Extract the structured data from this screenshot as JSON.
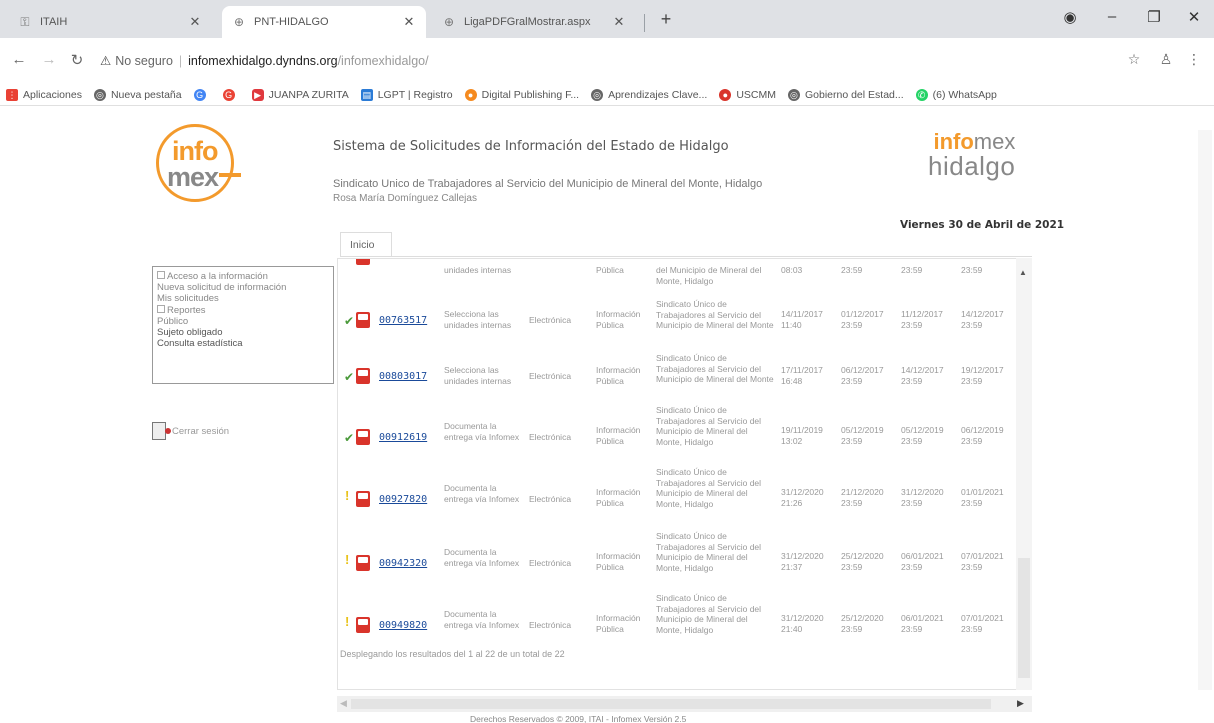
{
  "browser": {
    "tabs": [
      {
        "label": "ITAIH",
        "active": false
      },
      {
        "label": "PNT-HIDALGO",
        "active": true
      },
      {
        "label": "LigaPDFGralMostrar.aspx",
        "active": false
      }
    ],
    "address": {
      "security": "No seguro",
      "host": "infomexhidalgo.dyndns.org",
      "path": "/infomexhidalgo/"
    },
    "bookmarks": [
      {
        "label": "Aplicaciones",
        "icon": "apps-grid-icon",
        "color": "#e94235"
      },
      {
        "label": "Nueva pestaña",
        "icon": "globe-icon",
        "color": "#666666"
      },
      {
        "label": "",
        "icon": "google-icon",
        "color": "#4285f4"
      },
      {
        "label": "",
        "icon": "google-icon",
        "color": "#ea4335"
      },
      {
        "label": "JUANPA ZURITA",
        "icon": "youtube-icon",
        "color": "#e0393e"
      },
      {
        "label": "LGPT | Registro",
        "icon": "flag-icon",
        "color": "#2b7bd6"
      },
      {
        "label": "Digital Publishing F...",
        "icon": "circle-icon",
        "color": "#f58a1f"
      },
      {
        "label": "Aprendizajes Clave...",
        "icon": "globe-icon",
        "color": "#666666"
      },
      {
        "label": "USCMM",
        "icon": "circle-icon",
        "color": "#d9342b"
      },
      {
        "label": "Gobierno del Estad...",
        "icon": "globe-icon",
        "color": "#666666"
      },
      {
        "label": "(6) WhatsApp",
        "icon": "whatsapp-icon",
        "color": "#25d366"
      }
    ]
  },
  "header": {
    "logo_left_top": "info",
    "logo_left_bottom": "mex",
    "title": "Sistema de Solicitudes de Información del Estado de Hidalgo",
    "subtitle": "Sindicato Unico de Trabajadores al Servicio del Municipio de Mineral del Monte, Hidalgo",
    "user": "Rosa María Domínguez Callejas",
    "logo_right_a": "info",
    "logo_right_b": "mex",
    "logo_right_c": "hidalgo",
    "date": "Viernes 30 de Abril de 2021"
  },
  "tabs": {
    "inicio": "Inicio"
  },
  "menu": {
    "items": [
      {
        "label": "Acceso a la información",
        "square": true
      },
      {
        "label": "Nueva solicitud de información",
        "square": false
      },
      {
        "label": "Mis solicitudes",
        "square": false
      },
      {
        "label": "Reportes",
        "square": true
      },
      {
        "label": "Público",
        "square": false
      },
      {
        "label": "Sujeto obligado",
        "square": false
      },
      {
        "label": "Consulta estadística",
        "square": false
      }
    ],
    "logout": "Cerrar sesión"
  },
  "results": {
    "partial_row": {
      "desc": "unidades internas",
      "tipo": "Electrónica",
      "info": "Pública",
      "sujeto": "del Municipio de Mineral del Monte, Hidalgo",
      "d1": "08:03",
      "d2": "23:59",
      "d3": "23:59",
      "d4": "23:59"
    },
    "rows": [
      {
        "status": "check",
        "folio": "00763517",
        "desc": "Selecciona las unidades internas",
        "tipo": "Electrónica",
        "info": "Información Pública",
        "sujeto": "Sindicato Único de Trabajadores al Servicio del Municipio de Mineral del Monte",
        "d1": "14/11/2017 11:40",
        "d2": "01/12/2017 23:59",
        "d3": "11/12/2017 23:59",
        "d4": "14/12/2017 23:59"
      },
      {
        "status": "check",
        "folio": "00803017",
        "desc": "Selecciona las unidades internas",
        "tipo": "Electrónica",
        "info": "Información Pública",
        "sujeto": "Sindicato Único de Trabajadores al Servicio del Municipio de Mineral del Monte",
        "d1": "17/11/2017 16:48",
        "d2": "06/12/2017 23:59",
        "d3": "14/12/2017 23:59",
        "d4": "19/12/2017 23:59"
      },
      {
        "status": "check",
        "folio": "00912619",
        "desc": "Documenta la entrega vía Infomex",
        "tipo": "Electrónica",
        "info": "Información Pública",
        "sujeto": "Sindicato Único de Trabajadores al Servicio del Municipio de Mineral del Monte, Hidalgo",
        "d1": "19/11/2019 13:02",
        "d2": "05/12/2019 23:59",
        "d3": "05/12/2019 23:59",
        "d4": "06/12/2019 23:59"
      },
      {
        "status": "warn",
        "folio": "00927820",
        "desc": "Documenta la entrega vía Infomex",
        "tipo": "Electrónica",
        "info": "Información Pública",
        "sujeto": "Sindicato Único de Trabajadores al Servicio del Municipio de Mineral del Monte, Hidalgo",
        "d1": "31/12/2020 21:26",
        "d2": "21/12/2020 23:59",
        "d3": "31/12/2020 23:59",
        "d4": "01/01/2021 23:59"
      },
      {
        "status": "warn",
        "folio": "00942320",
        "desc": "Documenta la entrega vía Infomex",
        "tipo": "Electrónica",
        "info": "Información Pública",
        "sujeto": "Sindicato Único de Trabajadores al Servicio del Municipio de Mineral del Monte, Hidalgo",
        "d1": "31/12/2020 21:37",
        "d2": "25/12/2020 23:59",
        "d3": "06/01/2021 23:59",
        "d4": "07/01/2021 23:59"
      },
      {
        "status": "warn",
        "folio": "00949820",
        "desc": "Documenta la entrega vía Infomex",
        "tipo": "Electrónica",
        "info": "Información Pública",
        "sujeto": "Sindicato Único de Trabajadores al Servicio del Municipio de Mineral del Monte, Hidalgo",
        "d1": "31/12/2020 21:40",
        "d2": "25/12/2020 23:59",
        "d3": "06/01/2021 23:59",
        "d4": "07/01/2021 23:59"
      }
    ],
    "footer": "Desplegando los resultados del 1 al 22 de un total de 22"
  },
  "copyright": "Derechos Reservados © 2009, ITAI - Infomex Versión 2.5"
}
